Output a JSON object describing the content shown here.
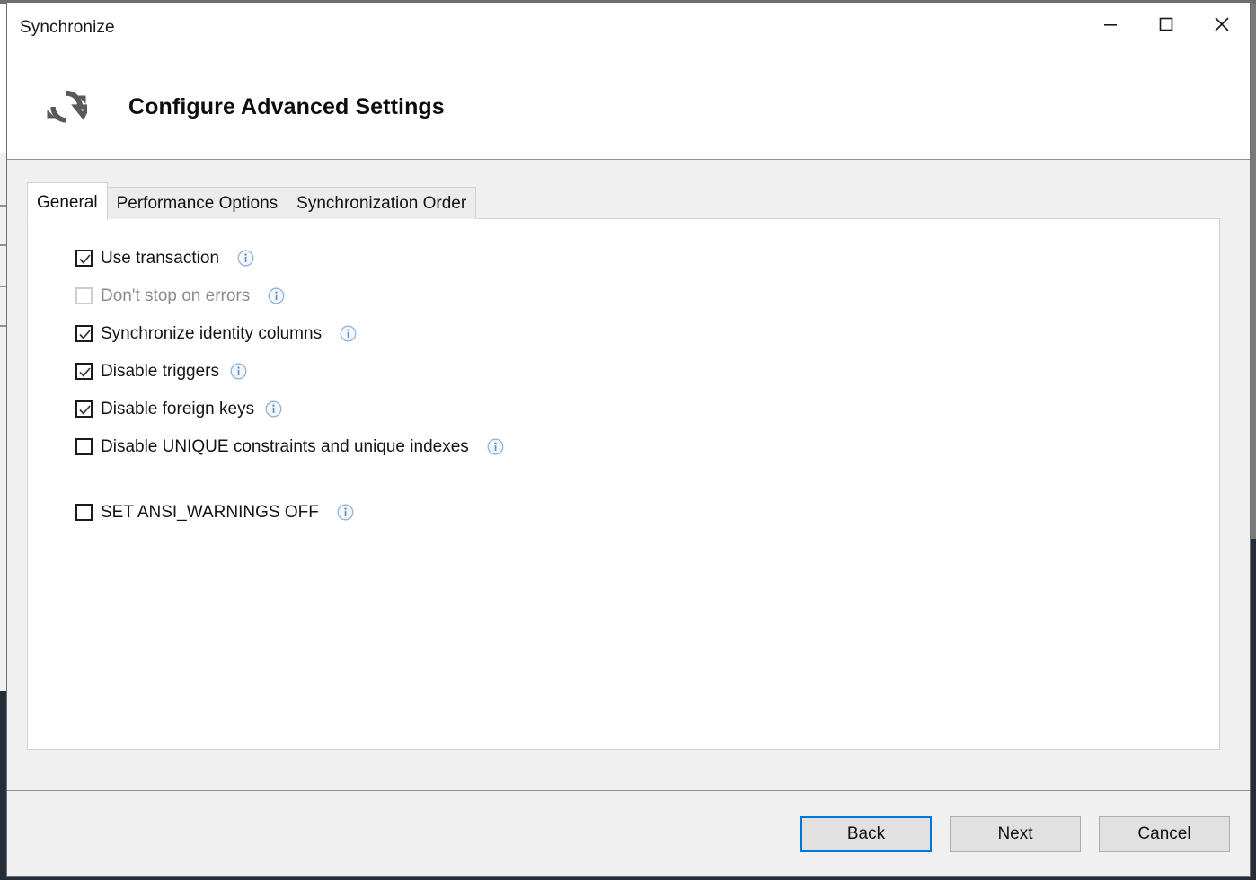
{
  "window": {
    "title": "Synchronize",
    "controls": [
      {
        "name": "minimize",
        "label": "—"
      },
      {
        "name": "maximize",
        "label": "☐"
      },
      {
        "name": "close",
        "label": "✕"
      }
    ]
  },
  "header": {
    "icon": "sync-refresh-icon",
    "title": "Configure Advanced Settings"
  },
  "tabs": [
    {
      "label": "General",
      "selected": true
    },
    {
      "label": "Performance Options",
      "selected": false
    },
    {
      "label": "Synchronization Order",
      "selected": false
    }
  ],
  "options": [
    {
      "label": "Use transaction",
      "checked": true,
      "enabled": true,
      "info": true,
      "wide_gap": true
    },
    {
      "label": "Don't stop on errors",
      "checked": false,
      "enabled": false,
      "info": true,
      "wide_gap": true
    },
    {
      "label": "Synchronize identity columns",
      "checked": true,
      "enabled": true,
      "info": true,
      "wide_gap": true
    },
    {
      "label": "Disable triggers",
      "checked": true,
      "enabled": true,
      "info": true,
      "wide_gap": false
    },
    {
      "label": "Disable foreign keys",
      "checked": true,
      "enabled": true,
      "info": true,
      "wide_gap": false
    },
    {
      "label": "Disable UNIQUE constraints and unique indexes",
      "checked": false,
      "enabled": true,
      "info": true,
      "wide_gap": true
    },
    {
      "label": "SET ANSI_WARNINGS OFF",
      "checked": false,
      "enabled": true,
      "info": true,
      "wide_gap": true,
      "spaced": true
    }
  ],
  "footer": {
    "buttons": [
      {
        "label": "Back",
        "focused": true
      },
      {
        "label": "Next",
        "focused": false
      },
      {
        "label": "Cancel",
        "focused": false
      }
    ]
  },
  "colors": {
    "accent_focus": "#0078d7",
    "info_icon": "#7aa7d4",
    "dialog_bg": "#f0f0f0",
    "panel_bg": "#ffffff",
    "disabled_text": "#8c8c8c"
  },
  "background_fragments": {
    "top_strip": "···   ······   ··   ····   ··"
  }
}
